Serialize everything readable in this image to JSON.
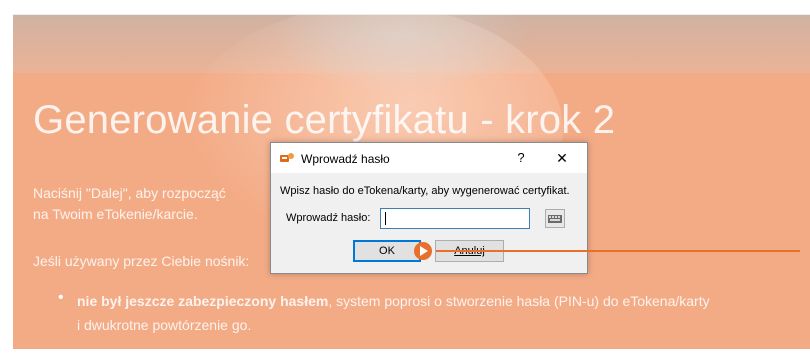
{
  "page": {
    "title": "Generowanie certyfikatu - krok 2",
    "line1": "Naciśnij \"Dalej\", aby rozpocząć",
    "line2": "na Twoim eTokenie/karcie.",
    "line3": "Jeśli używany przez Ciebie nośnik:",
    "bullet_bold": "nie był jeszcze zabezpieczony hasłem",
    "bullet_rest": ", system poprosi o stworzenie hasła (PIN-u) do eTokena/karty",
    "bullet_line2": "i dwukrotne powtórzenie go."
  },
  "dialog": {
    "title": "Wprowadź hasło",
    "help": "?",
    "close": "✕",
    "message": "Wpisz hasło do eTokena/karty, aby wygenerować certyfikat.",
    "label": "Wprowadź hasło:",
    "password_value": "",
    "ok_label": "OK",
    "cancel_label": "Anuluj"
  },
  "colors": {
    "overlay": "#f3ab86",
    "arrow": "#e8702a",
    "focus_blue": "#0078d7"
  }
}
